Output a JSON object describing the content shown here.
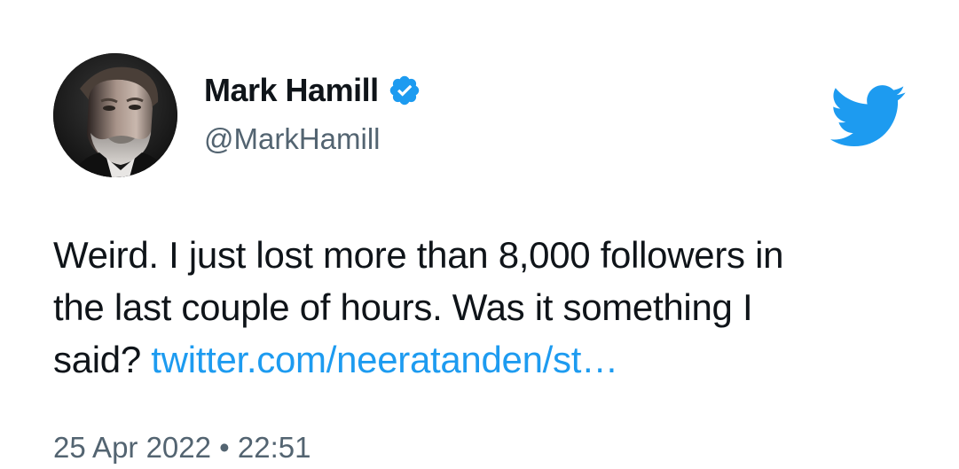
{
  "author": {
    "display_name": "Mark Hamill",
    "handle": "@MarkHamill",
    "verified": true,
    "avatar_icon": "profile-photo"
  },
  "brand": {
    "logo_icon": "twitter-bird-icon",
    "accent_color": "#1d9bf0"
  },
  "tweet": {
    "text_line1": "Weird. I just lost more than 8,000 followers in",
    "text_line2": "the last couple of hours. Was it something I",
    "text_line3_prefix": "said?",
    "link_text": "twitter.com/neeratanden/st…",
    "timestamp": "25 Apr 2022 • 22:51"
  },
  "colors": {
    "text": "#0f1419",
    "secondary_text": "#536471",
    "background": "#ffffff"
  }
}
